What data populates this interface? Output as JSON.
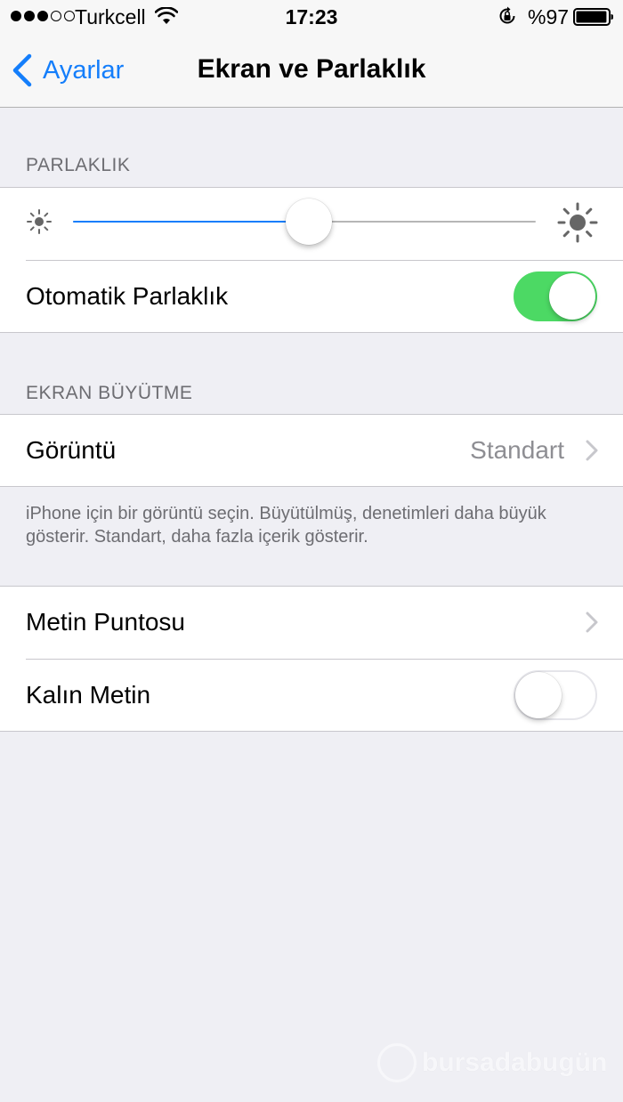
{
  "status_bar": {
    "signal_filled": 3,
    "signal_total": 5,
    "carrier": "Turkcell",
    "time": "17:23",
    "battery_percent": "%97",
    "battery_level": 0.97
  },
  "nav": {
    "back_label": "Ayarlar",
    "title": "Ekran ve Parlaklık"
  },
  "brightness": {
    "header": "PARLAKLIK",
    "slider_value": 0.51,
    "auto_label": "Otomatik Parlaklık",
    "auto_enabled": true
  },
  "display_zoom": {
    "header": "EKRAN BÜYÜTME",
    "view_label": "Görüntü",
    "view_value": "Standart",
    "footer": "iPhone için bir görüntü seçin. Büyütülmüş, denetimleri daha büyük gösterir. Standart, daha fazla içerik gösterir."
  },
  "text": {
    "text_size_label": "Metin Puntosu",
    "bold_text_label": "Kalın Metin",
    "bold_text_enabled": false
  },
  "watermark": {
    "text": "bursadabugün"
  },
  "colors": {
    "accent": "#147efb",
    "toggle_on": "#4cd964",
    "background": "#efeff4",
    "secondary_text": "#6d6d72"
  }
}
